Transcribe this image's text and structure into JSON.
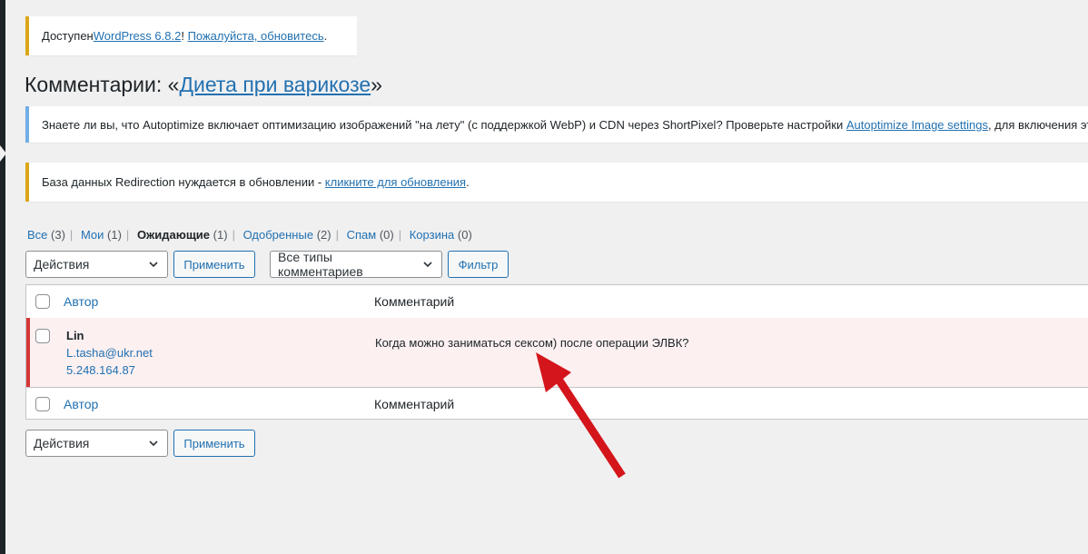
{
  "notices": {
    "update": {
      "prefix": "Доступен ",
      "link1": "WordPress 6.8.2",
      "middle": "! ",
      "link2": "Пожалуйста, обновитесь",
      "suffix": "."
    },
    "autoptimize": {
      "prefix": "Знаете ли вы, что Autoptimize включает оптимизацию изображений \"на лету\" (с поддержкой WebP) и CDN через ShortPixel? Проверьте настройки ",
      "link": "Autoptimize Image settings",
      "suffix": ", для включения эт"
    },
    "redirection": {
      "prefix": "База данных Redirection нуждается в обновлении - ",
      "link": "кликните для обновления",
      "suffix": "."
    }
  },
  "page": {
    "title_prefix": "Комментарии: «",
    "title_link": "Диета при варикозе",
    "title_suffix": "»"
  },
  "filters": [
    {
      "label": "Все",
      "count": "(3)",
      "current": false
    },
    {
      "label": "Мои",
      "count": "(1)",
      "current": false
    },
    {
      "label": "Ожидающие",
      "count": "(1)",
      "current": true
    },
    {
      "label": "Одобренные",
      "count": "(2)",
      "current": false
    },
    {
      "label": "Спам",
      "count": "(0)",
      "current": false
    },
    {
      "label": "Корзина",
      "count": "(0)",
      "current": false
    }
  ],
  "toolbar": {
    "bulk_actions": "Действия",
    "apply": "Применить",
    "comment_type": "Все типы комментариев",
    "filter": "Фильтр"
  },
  "table": {
    "col_author": "Автор",
    "col_comment": "Комментарий",
    "rows": [
      {
        "author": "Lin",
        "email": "L.tasha@ukr.net",
        "ip": "5.248.164.87",
        "comment": "Когда можно заниматься сексом) после операции ЭЛВК?"
      }
    ]
  },
  "colors": {
    "accent": "#2271b1",
    "warning": "#dba617",
    "info": "#72aee6",
    "pending_row_bg": "#fcf0f1",
    "pending_border": "#d63638",
    "annotation_arrow": "#d4151b"
  }
}
